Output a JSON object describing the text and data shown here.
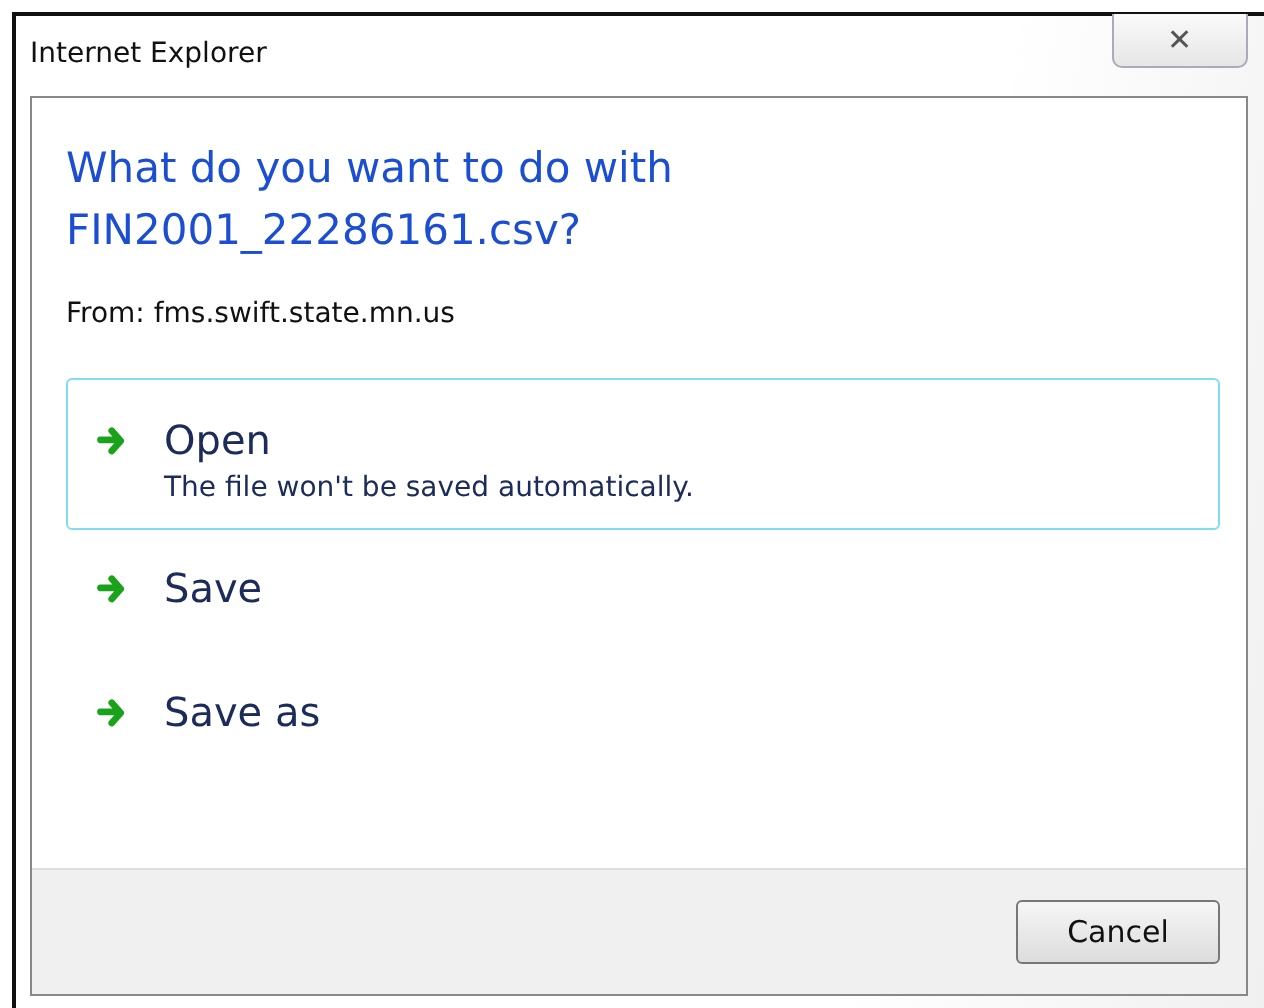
{
  "window": {
    "title": "Internet Explorer",
    "close": "✕"
  },
  "question": "What do you want to do with FIN2001_22286161.csv?",
  "source": "From: fms.swift.state.mn.us",
  "options": [
    {
      "label": "Open",
      "description": "The file won't be saved automatically.",
      "selected": true
    },
    {
      "label": "Save",
      "selected": false
    },
    {
      "label": "Save as",
      "selected": false
    }
  ],
  "buttons": [
    "Cancel"
  ]
}
